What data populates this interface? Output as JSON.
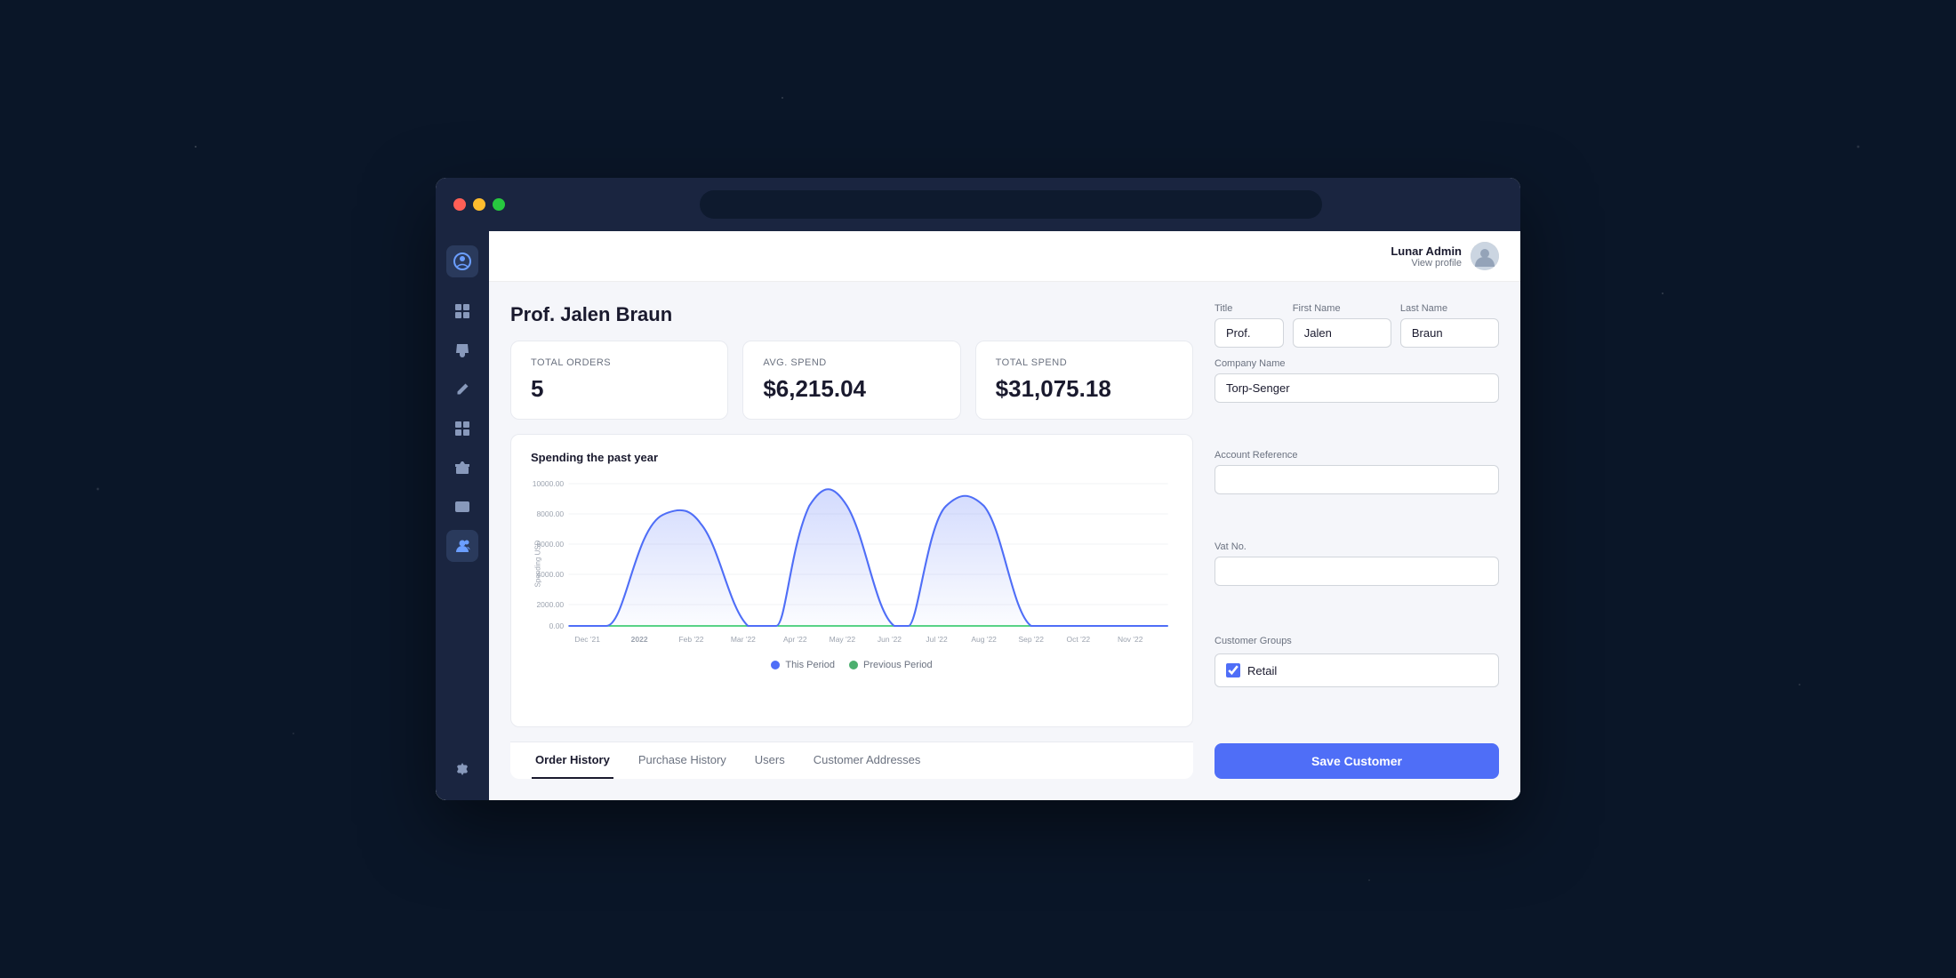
{
  "browser": {
    "url": ""
  },
  "header": {
    "user_name": "Lunar Admin",
    "user_link": "View profile"
  },
  "page": {
    "title": "Prof. Jalen Braun"
  },
  "stats": [
    {
      "label": "Total Orders",
      "value": "5"
    },
    {
      "label": "Avg. Spend",
      "value": "$6,215.04"
    },
    {
      "label": "Total Spend",
      "value": "$31,075.18"
    }
  ],
  "chart": {
    "title": "Spending the past year",
    "y_axis_label": "Spending USD",
    "legend": [
      {
        "label": "This Period",
        "color": "#4f6ef7"
      },
      {
        "label": "Previous Period",
        "color": "#4caf6f"
      }
    ],
    "x_labels": [
      "Dec '21",
      "2022",
      "Feb '22",
      "Mar '22",
      "Apr '22",
      "May '22",
      "Jun '22",
      "Jul '22",
      "Aug '22",
      "Sep '22",
      "Oct '22",
      "Nov '22"
    ],
    "y_labels": [
      "0.00",
      "2000.00",
      "4000.00",
      "6000.00",
      "8000.00",
      "10000.00"
    ]
  },
  "tabs": [
    {
      "label": "Order History",
      "active": true
    },
    {
      "label": "Purchase History",
      "active": false
    },
    {
      "label": "Users",
      "active": false
    },
    {
      "label": "Customer Addresses",
      "active": false
    }
  ],
  "form": {
    "title_label": "Title",
    "title_value": "Prof.",
    "first_name_label": "First Name",
    "first_name_value": "Jalen",
    "last_name_label": "Last Name",
    "last_name_value": "Braun",
    "company_name_label": "Company Name",
    "company_name_value": "Torp-Senger",
    "account_ref_label": "Account Reference",
    "account_ref_value": "",
    "vat_label": "Vat No.",
    "vat_value": "",
    "customer_groups_label": "Customer Groups",
    "groups": [
      {
        "label": "Retail",
        "checked": true
      }
    ],
    "save_button_label": "Save Customer"
  },
  "sidebar": {
    "icons": [
      {
        "name": "chart-icon",
        "symbol": "▦",
        "active": false
      },
      {
        "name": "bag-icon",
        "symbol": "🛍",
        "active": false
      },
      {
        "name": "edit-icon",
        "symbol": "✏",
        "active": false
      },
      {
        "name": "grid-icon",
        "symbol": "⊞",
        "active": false
      },
      {
        "name": "box-icon",
        "symbol": "📦",
        "active": false
      },
      {
        "name": "media-icon",
        "symbol": "🖼",
        "active": false
      },
      {
        "name": "users-icon",
        "symbol": "👥",
        "active": true
      },
      {
        "name": "settings-icon",
        "symbol": "⚙",
        "active": false
      }
    ]
  }
}
